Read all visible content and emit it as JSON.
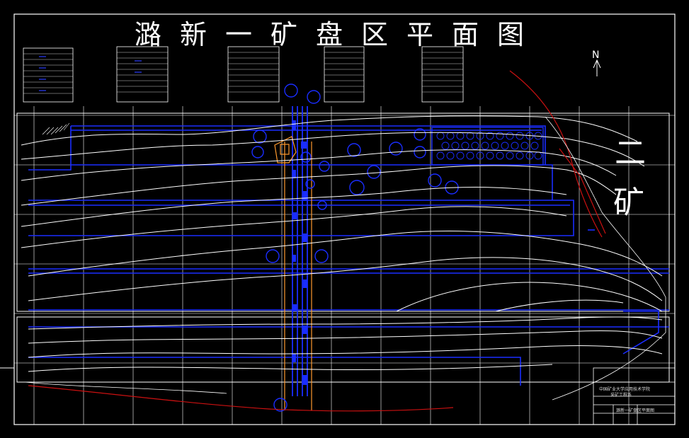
{
  "drawing": {
    "title": "潞新一矿盘区平面图",
    "north_label": "N",
    "side_label_top": "二",
    "side_label_bottom": "矿",
    "title_block": {
      "line1": "中国矿业大学应用技术学院",
      "line2": "采矿工程系",
      "drawing_name": "潞新一矿盘区平面图"
    }
  },
  "colors": {
    "background": "#000000",
    "frame": "#ffffff",
    "roadway": "#1a2dff",
    "contour": "#ffffff",
    "boundary": "#cc1111",
    "shaft": "#ff9a2e"
  }
}
